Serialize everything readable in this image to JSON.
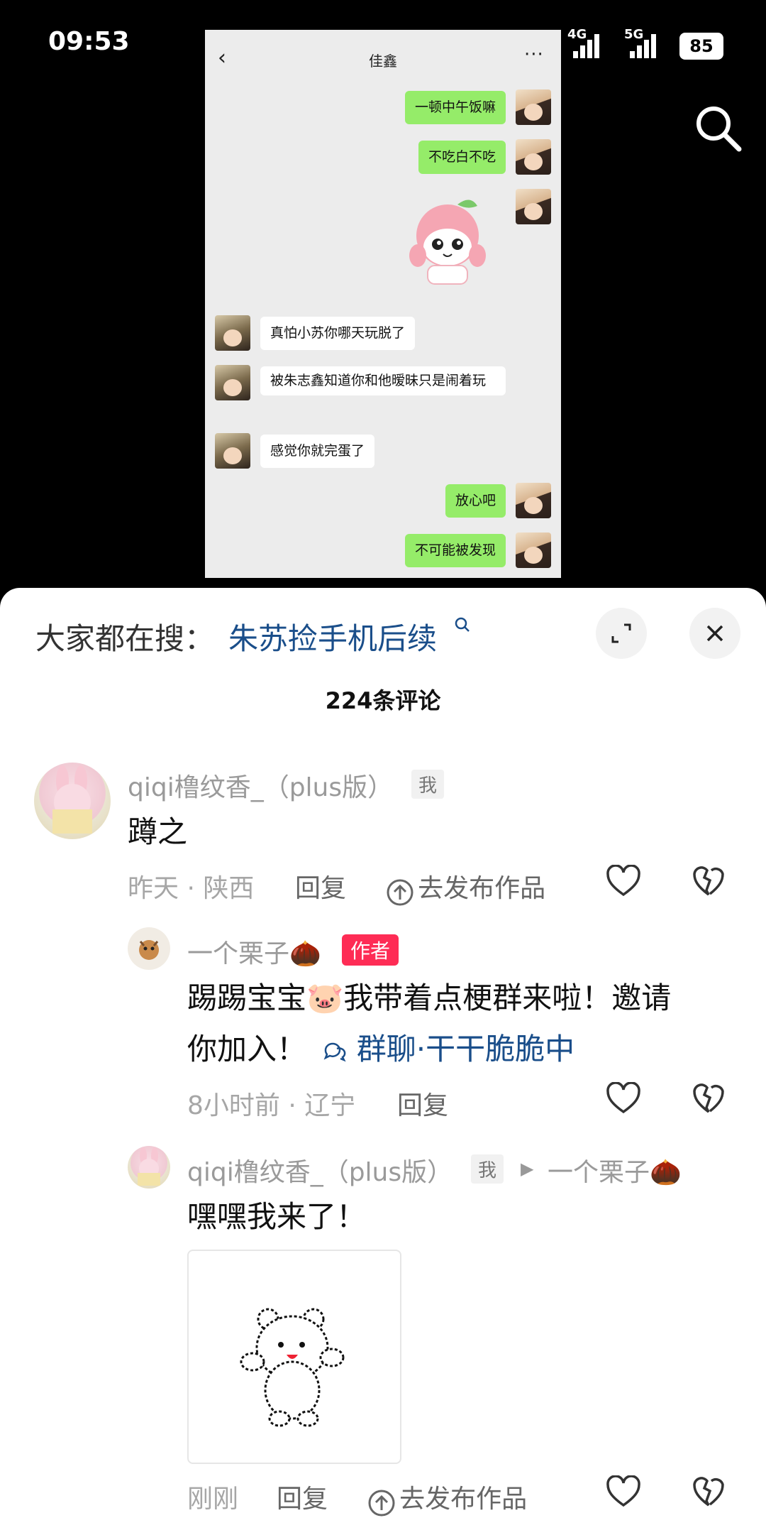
{
  "status": {
    "time": "09:53",
    "net1": "4G",
    "net2": "5G",
    "battery": "85"
  },
  "chat": {
    "title": "佳鑫",
    "back_icon": "chevron-left",
    "more_icon": "ellipsis",
    "messages": [
      {
        "side": "right",
        "text": "一顿中午饭嘛"
      },
      {
        "side": "right",
        "text": "不吃白不吃"
      },
      {
        "side": "right",
        "text": "",
        "sticker": "peach-character"
      },
      {
        "side": "left",
        "text": "真怕小苏你哪天玩脱了"
      },
      {
        "side": "left",
        "text": "被朱志鑫知道你和他暧昧只是闹着玩"
      },
      {
        "side": "left",
        "text": "感觉你就完蛋了"
      },
      {
        "side": "right",
        "text": "放心吧"
      },
      {
        "side": "right",
        "text": "不可能被发现"
      }
    ]
  },
  "search_bar": {
    "prefix": "大家都在搜：",
    "term": "朱苏捡手机后续",
    "icon": "search-icon"
  },
  "comments_title": "224条评论",
  "comments": [
    {
      "user": "qiqi橹纹香_（plus版）",
      "tag": "我",
      "text": "蹲之",
      "meta": "昨天 · 陕西",
      "reply": "回复",
      "publish": "去发布作品"
    },
    {
      "user": "一个栗子🌰",
      "tag": "作者",
      "text_before": "踢踢宝宝🐷我带着点梗群来啦！邀请",
      "text_after": "你加入！",
      "chip": "群聊·干干脆脆中",
      "meta": "8小时前 · 辽宁",
      "reply": "回复"
    },
    {
      "user": "qiqi橹纹香_（plus版）",
      "tag": "我",
      "reply_to": "一个栗子🌰",
      "text": "嘿嘿我来了！",
      "image": "white-bear-sticker",
      "meta": "刚刚",
      "reply": "回复",
      "publish": "去发布作品"
    }
  ]
}
